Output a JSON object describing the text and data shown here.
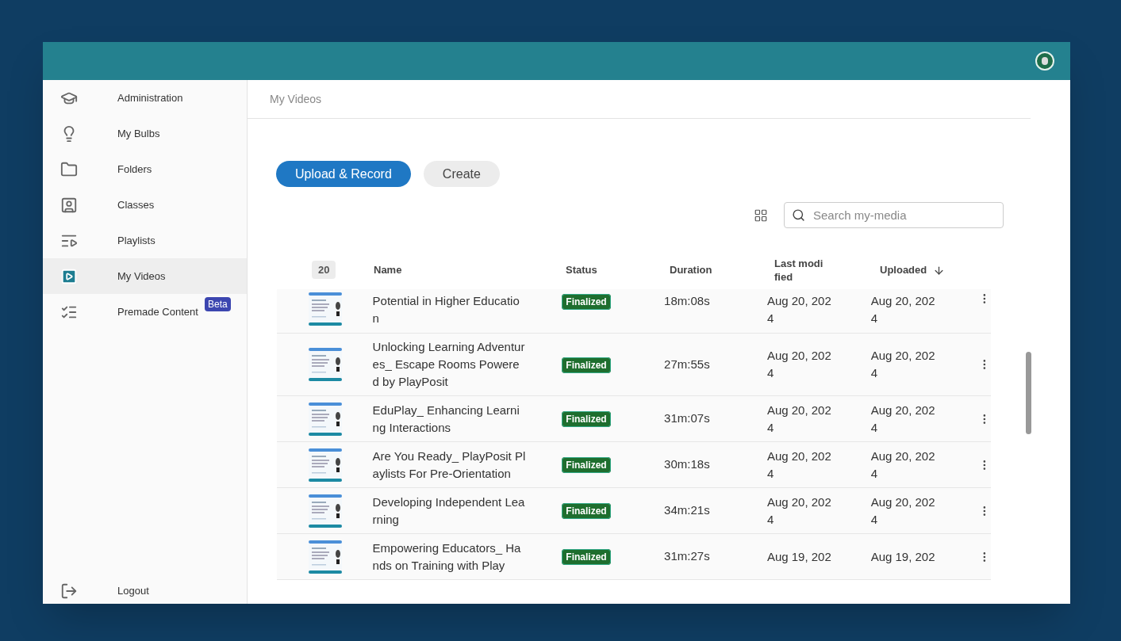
{
  "sidebar": {
    "items": [
      {
        "kind": "admin",
        "label": "Administration",
        "selected": false
      },
      {
        "kind": "bulb",
        "label": "My Bulbs",
        "selected": false
      },
      {
        "kind": "folder",
        "label": "Folders",
        "selected": false
      },
      {
        "kind": "classes",
        "label": "Classes",
        "selected": false
      },
      {
        "kind": "playlist",
        "label": "Playlists",
        "selected": false
      },
      {
        "kind": "video",
        "label": "My Videos",
        "selected": true
      },
      {
        "kind": "list",
        "label": "Premade Content",
        "selected": false,
        "badge": "Beta"
      }
    ],
    "logout": "Logout"
  },
  "breadcrumb": "My Videos",
  "buttons": [
    {
      "label": "Upload & Record",
      "kind": "primary"
    },
    {
      "label": "Create",
      "kind": "secondary"
    }
  ],
  "search": {
    "placeholder": "Search my-media"
  },
  "table": {
    "page_size": "20",
    "columns": [
      {
        "label": "Name"
      },
      {
        "label": "Status"
      },
      {
        "label": "Duration"
      },
      {
        "label": "Last modi fied"
      },
      {
        "label": "Uploaded",
        "sorted_descending": true
      }
    ],
    "rows": [
      {
        "name": "Potential in Higher Education",
        "status": "Finalized",
        "duration": "18m:08s",
        "modified": "Aug 20, 2024",
        "uploaded": "Aug 20, 2024"
      },
      {
        "name": "Unlocking Learning Adventures_ Escape Rooms Powered by PlayPosit",
        "status": "Finalized",
        "duration": "27m:55s",
        "modified": "Aug 20, 2024",
        "uploaded": "Aug 20, 2024"
      },
      {
        "name": "EduPlay_ Enhancing Learning Interactions",
        "status": "Finalized",
        "duration": "31m:07s",
        "modified": "Aug 20, 2024",
        "uploaded": "Aug 20, 2024"
      },
      {
        "name": "Are You Ready_ PlayPosit Playlists For Pre-Orientation",
        "status": "Finalized",
        "duration": "30m:18s",
        "modified": "Aug 20, 2024",
        "uploaded": "Aug 20, 2024"
      },
      {
        "name": "Developing Independent Learning",
        "status": "Finalized",
        "duration": "34m:21s",
        "modified": "Aug 20, 2024",
        "uploaded": "Aug 20, 2024"
      },
      {
        "name": "Empowering Educators_ Hands on Training with Play",
        "status": "Finalized",
        "duration": "31m:27s",
        "modified": "Aug 19, 202",
        "uploaded": "Aug 19, 202"
      }
    ]
  }
}
